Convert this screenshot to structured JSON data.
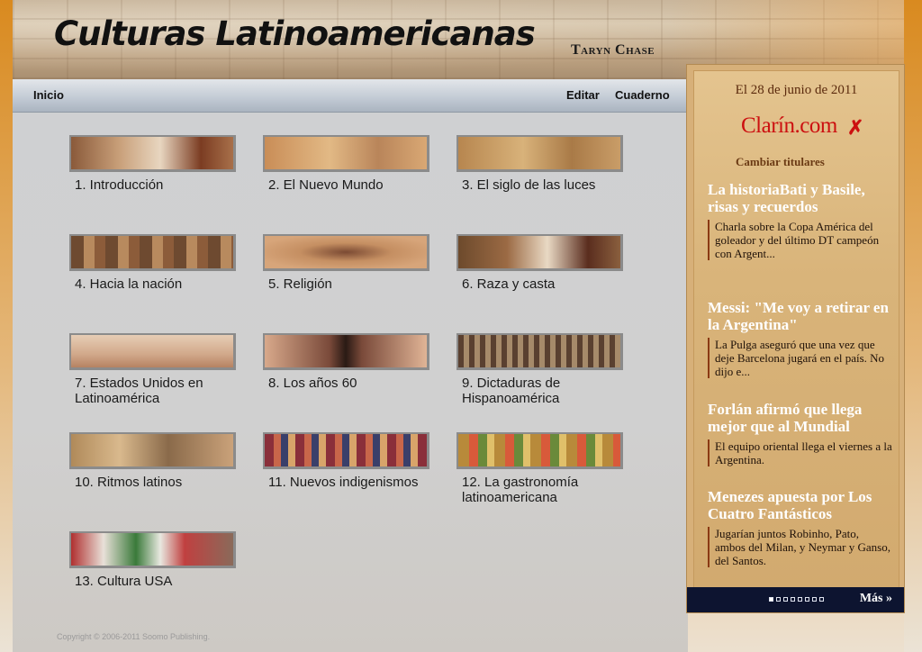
{
  "header": {
    "title": "Culturas Latinoamericanas",
    "user_name": "Taryn Chase"
  },
  "nav": {
    "home": "Inicio",
    "edit": "Editar",
    "notebook": "Cuaderno"
  },
  "chapters": [
    {
      "label": "1. Introducción"
    },
    {
      "label": "2. El Nuevo Mundo"
    },
    {
      "label": "3. El siglo de las luces"
    },
    {
      "label": "4. Hacia la nación"
    },
    {
      "label": "5. Religión"
    },
    {
      "label": "6. Raza y casta"
    },
    {
      "label": "7. Estados Unidos en Latinoamérica"
    },
    {
      "label": "8. Los años 60"
    },
    {
      "label": "9. Dictaduras de Hispanoamérica"
    },
    {
      "label": "10. Ritmos latinos"
    },
    {
      "label": "11. Nuevos indigenismos"
    },
    {
      "label": "12. La gastronomía latinoamericana"
    },
    {
      "label": "13. Cultura USA"
    }
  ],
  "news": {
    "date": "El 28 de junio de 2011",
    "source_logo": "Clarín.com",
    "change_link": "Cambiar titulares",
    "stories": [
      {
        "title": "La historiaBati y Basile, risas y recuerdos",
        "desc": "Charla sobre la Copa América del goleador y del último DT campeón con Argent..."
      },
      {
        "title": "Messi: \"Me voy a retirar en la Argentina\"",
        "desc": "La Pulga aseguró que una vez que deje Barcelona jugará en el país. No dijo e..."
      },
      {
        "title": "Forlán afirmó que llega mejor que al Mundial",
        "desc": "El equipo oriental llega el viernes a la Argentina."
      },
      {
        "title": "Menezes apuesta por Los Cuatro Fantásticos",
        "desc": "Jugarían juntos Robinho, Pato, ambos del Milan, y Neymar y Ganso, del Santos."
      }
    ],
    "page_count": 8,
    "active_page": 1,
    "more_label": "Más »"
  },
  "footer": {
    "copyright": "Copyright © 2006-2011 Soomo Publishing."
  }
}
